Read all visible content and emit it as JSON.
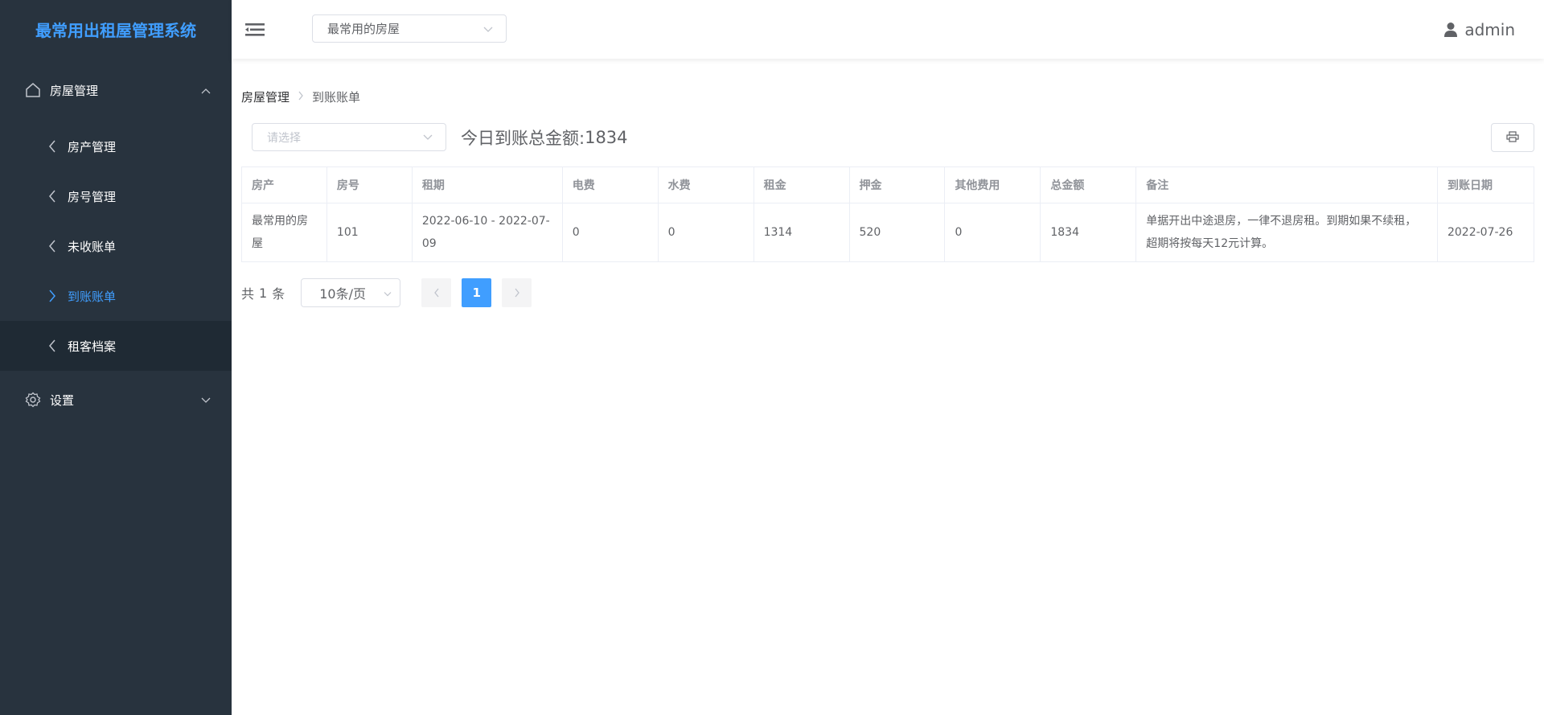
{
  "sidebar": {
    "brand": "最常用出租屋管理系统",
    "group_house": "房屋管理",
    "items": [
      {
        "label": "房产管理"
      },
      {
        "label": "房号管理"
      },
      {
        "label": "未收账单"
      },
      {
        "label": "到账账单"
      },
      {
        "label": "租客档案"
      }
    ],
    "group_settings": "设置",
    "active_color": "#409eff",
    "bg_color": "#28333e"
  },
  "header": {
    "property_select": "最常用的房屋",
    "user": "admin"
  },
  "breadcrumb": {
    "root": "房屋管理",
    "current": "到账账单"
  },
  "filter": {
    "placeholder": "请选择",
    "total_label": "今日到账总金额:",
    "total_value": "1834"
  },
  "table": {
    "columns": [
      "房产",
      "房号",
      "租期",
      "电费",
      "水费",
      "租金",
      "押金",
      "其他费用",
      "总金额",
      "备注",
      "到账日期"
    ],
    "rows": [
      {
        "property": "最常用的房屋",
        "room": "101",
        "period": "2022-06-10 - 2022-07-09",
        "electricity": "0",
        "water": "0",
        "rent": "1314",
        "deposit": "520",
        "other": "0",
        "total": "1834",
        "note": "单据开出中途退房，一律不退房租。到期如果不续租，超期将按每天12元计算。",
        "date": "2022-07-26"
      }
    ]
  },
  "pagination": {
    "total_prefix": "共",
    "total_count": "1",
    "total_suffix": "条",
    "page_size": "10条/页",
    "current_page": "1"
  }
}
